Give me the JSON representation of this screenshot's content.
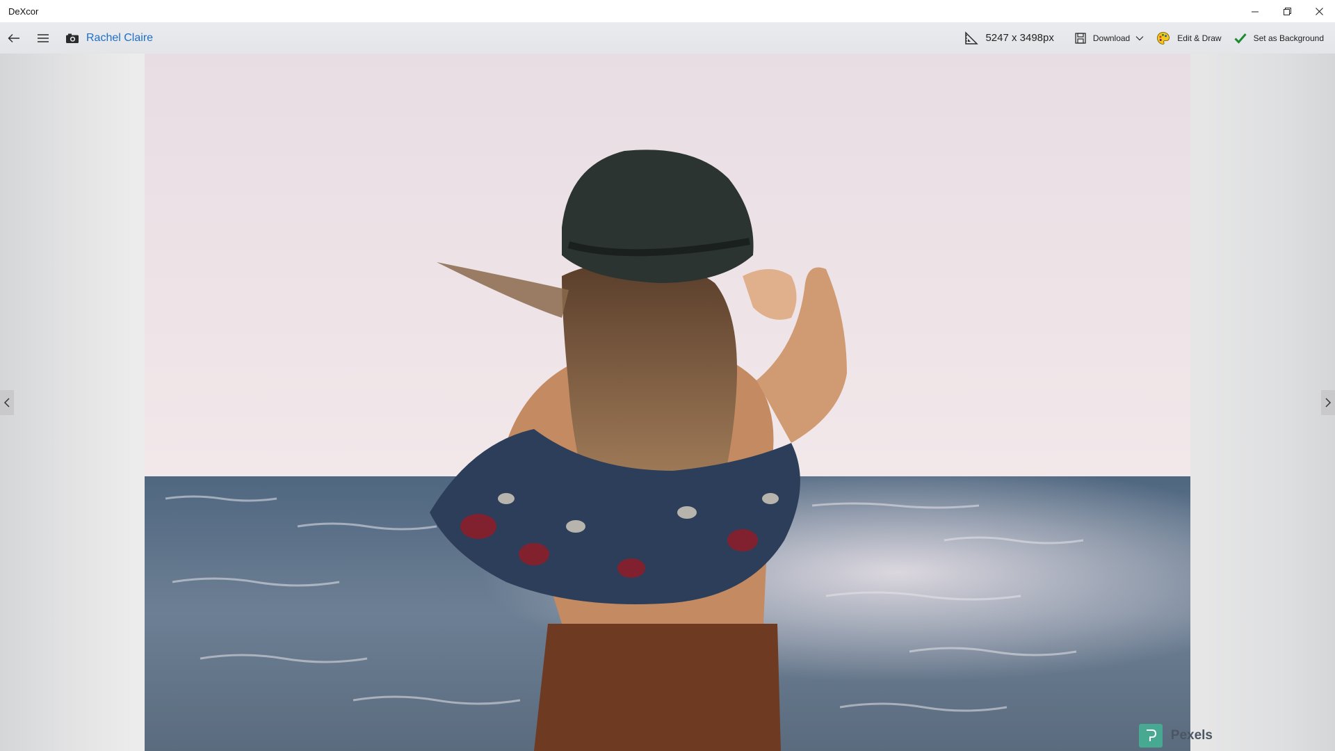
{
  "app": {
    "title": "DeXcor"
  },
  "window_controls": {
    "minimize_icon": "minimize-icon",
    "restore_icon": "restore-icon",
    "close_icon": "close-icon"
  },
  "toolbar": {
    "back_icon": "back-arrow-icon",
    "menu_icon": "hamburger-menu-icon",
    "photographer_icon": "camera-icon",
    "photographer_name": "Rachel Claire",
    "resolution_icon": "ruler-triangle-icon",
    "resolution": "5247 x 3498px",
    "download_label": "Download",
    "edit_label": "Edit & Draw",
    "background_label": "Set as Background"
  },
  "viewer": {
    "prev_icon": "chevron-left-icon",
    "next_icon": "chevron-right-icon",
    "source_label": "Pexels",
    "colors": {
      "sky": "#ece0e5",
      "sea": "#5b6f86",
      "hat": "#2b3431",
      "hair": "#8a6a4b",
      "skirt": "#6e3b22",
      "accent": "#1d6fc9"
    }
  }
}
